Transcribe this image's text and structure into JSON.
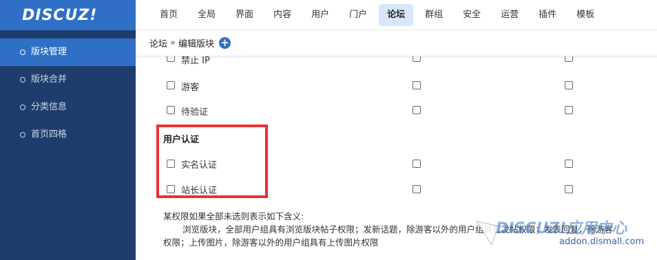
{
  "logo": {
    "text": "DISCUZ!"
  },
  "topnav": {
    "items": [
      {
        "label": "首页",
        "active": false
      },
      {
        "label": "全局",
        "active": false
      },
      {
        "label": "界面",
        "active": false
      },
      {
        "label": "内容",
        "active": false
      },
      {
        "label": "用户",
        "active": false
      },
      {
        "label": "门户",
        "active": false
      },
      {
        "label": "论坛",
        "active": true
      },
      {
        "label": "群组",
        "active": false
      },
      {
        "label": "安全",
        "active": false
      },
      {
        "label": "运营",
        "active": false
      },
      {
        "label": "插件",
        "active": false
      },
      {
        "label": "模板",
        "active": false
      }
    ]
  },
  "sidebar": {
    "items": [
      {
        "label": "版块管理",
        "active": true
      },
      {
        "label": "版块合并",
        "active": false
      },
      {
        "label": "分类信息",
        "active": false
      },
      {
        "label": "首页四格",
        "active": false
      }
    ]
  },
  "breadcrumb": {
    "root": "论坛",
    "separator": "»",
    "current": "编辑版块",
    "add_icon": "plus-icon"
  },
  "permissions": {
    "rows_top": [
      {
        "label": "禁止 IP"
      },
      {
        "label": "游客"
      },
      {
        "label": "待验证"
      }
    ],
    "group_title": "用户认证",
    "rows_group": [
      {
        "label": "实名认证"
      },
      {
        "label": "站长认证"
      }
    ]
  },
  "notes": {
    "line1": "某权限如果全部未选则表示如下含义:",
    "line2": "浏览版块，全部用户组具有浏览版块帖子权限；发新话题，除游客以外的用户组具有发帖权限；发表回复，除游客",
    "line3": "权限；上传图片，除游客以外的用户组具有上传图片权限"
  },
  "watermark": {
    "logo": "DISCUZ!应用中心",
    "url": "addon.dismall.com"
  },
  "colors": {
    "brand": "#2f6fc6",
    "sidebar_bg": "#1f3d6c",
    "highlight": "#e8303a"
  }
}
